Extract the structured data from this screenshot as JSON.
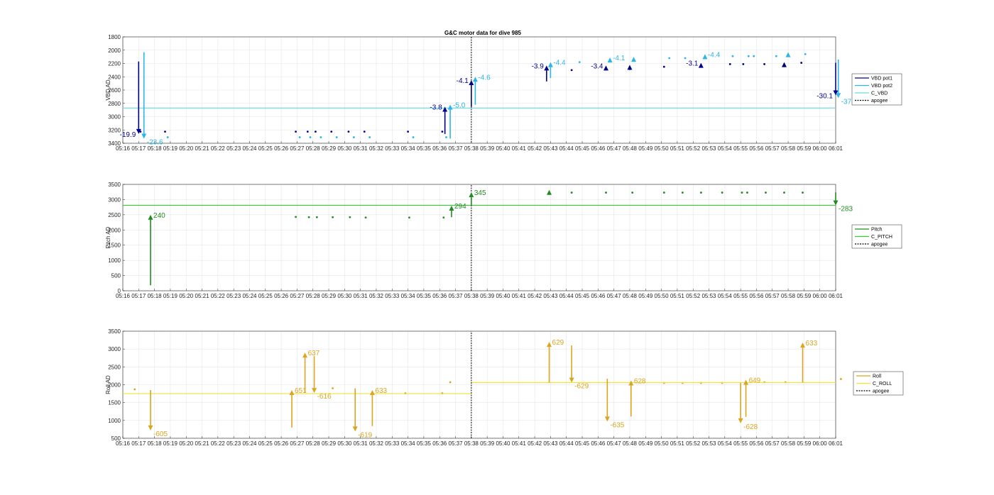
{
  "title": "G&C motor data for dive 985",
  "x_ticks": [
    "05:16",
    "05:17",
    "05:18",
    "05:19",
    "05:20",
    "05:21",
    "05:22",
    "05:23",
    "05:24",
    "05:25",
    "05:26",
    "05:27",
    "05:28",
    "05:29",
    "05:30",
    "05:31",
    "05:32",
    "05:33",
    "05:34",
    "05:35",
    "05:36",
    "05:37",
    "05:38",
    "05:39",
    "05:40",
    "05:41",
    "05:42",
    "05:43",
    "05:44",
    "05:45",
    "05:46",
    "05:47",
    "05:48",
    "05:49",
    "05:50",
    "05:51",
    "05:52",
    "05:53",
    "05:54",
    "05:55",
    "05:56",
    "05:57",
    "05:58",
    "05:59",
    "06:00",
    "06:01"
  ],
  "colors": {
    "pot1": "#00008b",
    "pot2": "#2cb5e8",
    "c_vbd": "#66d9e8",
    "pitch": "#228b22",
    "c_pitch": "#32cd32",
    "roll": "#daa520",
    "c_roll": "#f0e040",
    "apogee": "#000000",
    "grid": "#e6e6e6"
  },
  "chart_data": [
    {
      "type": "line",
      "title": "G&C motor data for dive 985",
      "ylabel": "VBD AD",
      "ylim": [
        1800,
        3400
      ],
      "y_reversed": true,
      "y_ticks": [
        "1800",
        "2000",
        "2200",
        "2400",
        "2600",
        "2800",
        "3000",
        "3200",
        "3400"
      ],
      "grid": true,
      "legend_position": "right",
      "apogee_time": "05:38",
      "series": [
        {
          "name": "VBD pot1",
          "x": [
            "05:17:07",
            "05:18:40",
            "05:26:55",
            "05:27:40",
            "05:28:10",
            "05:29:10",
            "05:30:15",
            "05:31:15",
            "05:34:00",
            "05:36:10"
          ],
          "values": [
            3225,
            3225,
            3225,
            3225,
            3225,
            3225,
            3225,
            3225,
            3225,
            3225
          ]
        },
        {
          "name": "VBD pot2",
          "x": [
            "05:18:50",
            "05:27:10",
            "05:27:50",
            "05:28:30",
            "05:29:30",
            "05:30:35",
            "05:31:35",
            "05:34:20",
            "05:36:25"
          ],
          "values": [
            3310,
            3310,
            3310,
            3310,
            3310,
            3310,
            3310,
            3310,
            3310
          ]
        },
        {
          "name": "VBD pot1",
          "x": [
            "05:44:20",
            "05:50:10",
            "05:54:20",
            "05:55:10",
            "05:56:30",
            "05:58:50"
          ],
          "values": [
            2300,
            2250,
            2210,
            2210,
            2210,
            2190
          ]
        },
        {
          "name": "VBD pot2",
          "x": [
            "05:44:50",
            "05:50:30",
            "05:51:30",
            "05:54:30",
            "05:55:30",
            "05:55:50",
            "05:57:15",
            "05:59:05"
          ],
          "values": [
            2180,
            2120,
            2120,
            2090,
            2090,
            2090,
            2090,
            2060
          ]
        },
        {
          "name": "C_VBD",
          "x": [
            "05:16:00",
            "06:01:00"
          ],
          "values": [
            2870,
            2870
          ]
        },
        {
          "name": "apogee",
          "x": [
            "05:38:00",
            "05:38:00"
          ],
          "values": [
            1800,
            3400
          ]
        }
      ],
      "moves": [
        {
          "series": "VBD pot1",
          "time": "05:17:00",
          "from": 2170,
          "to": 3260,
          "label": "-19.9"
        },
        {
          "series": "VBD pot2",
          "time": "05:17:20",
          "from": 2030,
          "to": 3330,
          "label": "-23.6"
        },
        {
          "series": "VBD pot1",
          "time": "05:36:20",
          "from": 3260,
          "to": 2850,
          "label": "-3.8"
        },
        {
          "series": "VBD pot2",
          "time": "05:36:40",
          "from": 3330,
          "to": 2820,
          "label": "-5.0"
        },
        {
          "series": "VBD pot1",
          "time": "05:38:00",
          "from": 2850,
          "to": 2450,
          "label": "-4.1"
        },
        {
          "series": "VBD pot2",
          "time": "05:38:15",
          "from": 2820,
          "to": 2400,
          "label": "-4.6"
        },
        {
          "series": "VBD pot1",
          "time": "05:42:45",
          "from": 2470,
          "to": 2230,
          "label": "-3.9"
        },
        {
          "series": "VBD pot2",
          "time": "05:43:00",
          "from": 2420,
          "to": 2180,
          "label": "-4.4"
        },
        {
          "series": "VBD pot1",
          "time": "05:46:30",
          "from": 2300,
          "to": 2230,
          "label": "-3.4"
        },
        {
          "series": "VBD pot2",
          "time": "05:46:45",
          "from": 2180,
          "to": 2110,
          "label": "-4.1"
        },
        {
          "series": "VBD pot1",
          "time": "05:48:00",
          "from": 2300,
          "to": 2220,
          "label": ""
        },
        {
          "series": "VBD pot2",
          "time": "05:48:15",
          "from": 2170,
          "to": 2100,
          "label": ""
        },
        {
          "series": "VBD pot1",
          "time": "05:52:30",
          "from": 2260,
          "to": 2190,
          "label": "-3.1"
        },
        {
          "series": "VBD pot2",
          "time": "05:52:45",
          "from": 2130,
          "to": 2060,
          "label": "-4.4"
        },
        {
          "series": "VBD pot1",
          "time": "05:57:45",
          "from": 2250,
          "to": 2180,
          "label": ""
        },
        {
          "series": "VBD pot2",
          "time": "05:58:00",
          "from": 2100,
          "to": 2030,
          "label": ""
        },
        {
          "series": "VBD pot1",
          "time": "06:01:00",
          "from": 2190,
          "to": 2680,
          "label": "-30.1"
        },
        {
          "series": "VBD pot2",
          "time": "06:01:10",
          "from": 2140,
          "to": 2720,
          "label": "-37"
        }
      ]
    },
    {
      "type": "line",
      "ylabel": "Pitch AD",
      "ylim": [
        0,
        3500
      ],
      "y_ticks": [
        "0",
        "500",
        "1000",
        "1500",
        "2000",
        "2500",
        "3000",
        "3500"
      ],
      "grid": true,
      "legend_position": "right",
      "apogee_time": "05:38",
      "series": [
        {
          "name": "Pitch",
          "x": [
            "05:26:55",
            "05:27:45",
            "05:28:15",
            "05:29:15",
            "05:30:20",
            "05:31:20",
            "05:34:05",
            "05:36:15",
            "05:44:20",
            "05:46:30",
            "05:48:10",
            "05:50:10",
            "05:51:20",
            "05:52:30",
            "05:53:50",
            "05:55:05",
            "05:55:25",
            "05:56:35",
            "05:57:45",
            "05:58:55"
          ],
          "values": [
            2430,
            2420,
            2420,
            2420,
            2420,
            2410,
            2410,
            2410,
            3230,
            3230,
            3230,
            3230,
            3230,
            3230,
            3230,
            3230,
            3230,
            3230,
            3230,
            3230
          ]
        },
        {
          "name": "C_PITCH",
          "x": [
            "05:16:00",
            "06:01:00"
          ],
          "values": [
            2810,
            2810
          ]
        },
        {
          "name": "apogee",
          "x": [
            "05:38:00",
            "05:38:00"
          ],
          "values": [
            0,
            3500
          ]
        }
      ],
      "moves": [
        {
          "series": "Pitch",
          "time": "05:17:45",
          "from": 180,
          "to": 2500,
          "label": "240"
        },
        {
          "series": "Pitch",
          "time": "05:36:45",
          "from": 2420,
          "to": 2800,
          "label": "294"
        },
        {
          "series": "Pitch",
          "time": "05:38:00",
          "from": 2800,
          "to": 3240,
          "label": "345"
        },
        {
          "series": "Pitch",
          "time": "05:42:55",
          "from": 3230,
          "to": 3320,
          "label": ""
        },
        {
          "series": "Pitch",
          "time": "06:01:00",
          "from": 3240,
          "to": 2810,
          "label": "-283"
        }
      ]
    },
    {
      "type": "line",
      "ylabel": "Roll AD",
      "ylim": [
        500,
        3500
      ],
      "y_ticks": [
        "500",
        "1000",
        "1500",
        "2000",
        "2500",
        "3000",
        "3500"
      ],
      "grid": true,
      "legend_position": "right",
      "apogee_time": "05:38",
      "series": [
        {
          "name": "Roll",
          "x": [
            "05:16:45",
            "05:29:15",
            "05:33:50",
            "05:36:10",
            "05:36:40",
            "05:50:10",
            "05:51:20",
            "05:52:30",
            "05:53:50",
            "05:56:30",
            "05:57:50",
            "06:01:20"
          ],
          "values": [
            1870,
            1900,
            1760,
            1760,
            2070,
            2050,
            2050,
            2050,
            2050,
            2070,
            2070,
            2160
          ]
        },
        {
          "name": "C_ROLL",
          "x": [
            "05:16:00",
            "05:38:00"
          ],
          "values": [
            1750,
            1750
          ]
        },
        {
          "name": "C_ROLL",
          "x": [
            "05:38:00",
            "06:01:00"
          ],
          "values": [
            2060,
            2060
          ]
        },
        {
          "name": "apogee",
          "x": [
            "05:38:00",
            "05:38:00"
          ],
          "values": [
            500,
            3500
          ]
        }
      ],
      "moves": [
        {
          "series": "Roll",
          "time": "05:17:45",
          "from": 1850,
          "to": 720,
          "label": "-605"
        },
        {
          "series": "Roll",
          "time": "05:26:40",
          "from": 800,
          "to": 1850,
          "label": "651"
        },
        {
          "series": "Roll",
          "time": "05:27:30",
          "from": 1780,
          "to": 2900,
          "label": "637"
        },
        {
          "series": "Roll",
          "time": "05:28:05",
          "from": 2800,
          "to": 1770,
          "label": "-616"
        },
        {
          "series": "Roll",
          "time": "05:30:40",
          "from": 1900,
          "to": 690,
          "label": "-619"
        },
        {
          "series": "Roll",
          "time": "05:31:45",
          "from": 840,
          "to": 1850,
          "label": "633"
        },
        {
          "series": "Roll",
          "time": "05:42:55",
          "from": 2060,
          "to": 3200,
          "label": "629"
        },
        {
          "series": "Roll",
          "time": "05:44:20",
          "from": 3100,
          "to": 2060,
          "label": "-629"
        },
        {
          "series": "Roll",
          "time": "05:46:35",
          "from": 2170,
          "to": 970,
          "label": "-635"
        },
        {
          "series": "Roll",
          "time": "05:48:05",
          "from": 1110,
          "to": 2120,
          "label": "628"
        },
        {
          "series": "Roll",
          "time": "05:55:00",
          "from": 2050,
          "to": 920,
          "label": "-628"
        },
        {
          "series": "Roll",
          "time": "05:55:20",
          "from": 1100,
          "to": 2140,
          "label": "649"
        },
        {
          "series": "Roll",
          "time": "05:58:55",
          "from": 2060,
          "to": 3180,
          "label": "633"
        }
      ]
    }
  ],
  "legends": [
    [
      {
        "label": "VBD pot1",
        "color_key": "pot1",
        "dash": false
      },
      {
        "label": "VBD pot2",
        "color_key": "pot2",
        "dash": false
      },
      {
        "label": "C_VBD",
        "color_key": "c_vbd",
        "dash": false
      },
      {
        "label": "apogee",
        "color_key": "apogee",
        "dash": true
      }
    ],
    [
      {
        "label": "Pitch",
        "color_key": "pitch",
        "dash": false
      },
      {
        "label": "C_PITCH",
        "color_key": "c_pitch",
        "dash": false
      },
      {
        "label": "apogee",
        "color_key": "apogee",
        "dash": true
      }
    ],
    [
      {
        "label": "Roll",
        "color_key": "roll",
        "dash": false
      },
      {
        "label": "C_ROLL",
        "color_key": "c_roll",
        "dash": false
      },
      {
        "label": "apogee",
        "color_key": "apogee",
        "dash": true
      }
    ]
  ]
}
